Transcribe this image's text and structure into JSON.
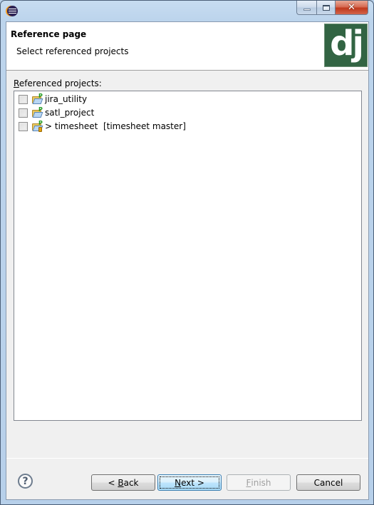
{
  "window": {
    "title": "",
    "controls": {
      "minimize": "minimize",
      "maximize": "maximize",
      "close": "✕"
    }
  },
  "banner": {
    "title": "Reference page",
    "subtitle": "Select referenced projects",
    "logo_text": "dj",
    "logo_color": "#326443"
  },
  "list": {
    "label_mnemonic": "R",
    "label_rest": "eferenced projects:",
    "items": [
      {
        "label": "jira_utility",
        "checked": false,
        "icon": "project-folder-icon"
      },
      {
        "label": "satl_project",
        "checked": false,
        "icon": "project-folder-icon"
      },
      {
        "label": "> timesheet  [timesheet master]",
        "checked": false,
        "icon": "git-project-folder-icon"
      }
    ]
  },
  "footer": {
    "help_glyph": "?",
    "buttons": {
      "back_prefix": "< ",
      "back_mnemonic": "B",
      "back_rest": "ack",
      "next_mnemonic": "N",
      "next_rest": "ext >",
      "finish_mnemonic": "F",
      "finish_rest": "inish",
      "cancel": "Cancel"
    }
  }
}
